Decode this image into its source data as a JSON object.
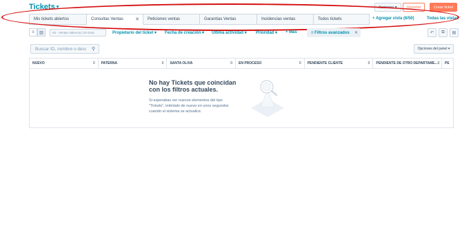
{
  "header": {
    "title": "Tickets",
    "actions_label": "Acciones",
    "import_label": "Importar",
    "create_label": "Crear ticket"
  },
  "tabs": [
    {
      "label": "Mis tickets abiertos"
    },
    {
      "label": "Consultas Ventas"
    },
    {
      "label": "Peticiones ventas"
    },
    {
      "label": "Garantías Ventas"
    },
    {
      "label": "Incidencias ventas"
    },
    {
      "label": "Todos tickets"
    }
  ],
  "add_view_label": "+ Agregar vista (6/50)",
  "all_views_label": "Todas las vistas",
  "filters": {
    "pipeline_value": "03 - Ventas Valencia | 03 Gest.",
    "owner_label": "Propietario del ticket",
    "created_label": "Fecha de creación",
    "last_activity_label": "Última actividad",
    "priority_label": "Prioridad",
    "more_label": "+ Más",
    "advanced_label": "Filtros avanzados"
  },
  "search": {
    "placeholder": "Buscar ID, nombre o desc",
    "panel_options_label": "Opciones del panel"
  },
  "columns": [
    {
      "label": "NUEVO",
      "count": "0"
    },
    {
      "label": "PATERNA",
      "count": "0"
    },
    {
      "label": "SANTA OLIVA",
      "count": "0"
    },
    {
      "label": "EN PROCESO",
      "count": "0"
    },
    {
      "label": "PENDIENTE CLIENTE",
      "count": "0"
    },
    {
      "label": "PENDIENTE DE OTRO DEPARTAME...",
      "count": "0"
    },
    {
      "label": "PE",
      "count": ""
    }
  ],
  "empty_state": {
    "title": "No hay Tickets que coincidan con los filtros actuales.",
    "text": "Si esperabas ver nuevos elementos del tipo \"Tickets\", inténtalo de nuevo en unos segundos cuando el sistema se actualice."
  },
  "colors": {
    "accent": "#0091ae",
    "primary_button": "#ff7a59",
    "annotation": "#d40f0f"
  }
}
